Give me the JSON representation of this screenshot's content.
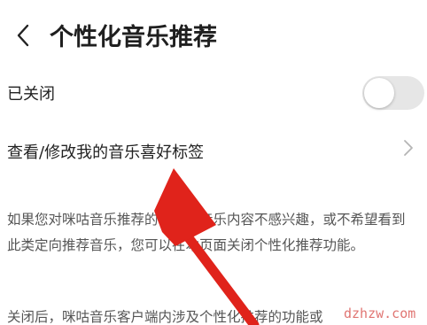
{
  "header": {
    "back_icon": "chevron-left-icon",
    "title": "个性化音乐推荐"
  },
  "settings": {
    "toggle_row": {
      "label": "已关闭",
      "state": "off"
    },
    "tags_row": {
      "label": "查看/修改我的音乐喜好标签",
      "icon": "chevron-right-icon"
    }
  },
  "description": {
    "paragraph1": "如果您对咪咕音乐推荐的个性化音乐内容不感兴趣，或不希望看到此类定向推荐音乐，您可以在本页面关闭个性化推荐功能。",
    "paragraph2": "关闭后，咪咕音乐客户端内涉及个性化推荐的功能或"
  },
  "overlay": {
    "watermark": "dzhzw.com",
    "arrow_color": "#e0231b"
  },
  "colors": {
    "toggle_off": "#e6e6e6",
    "text_primary": "#222222",
    "text_secondary": "#555555"
  }
}
